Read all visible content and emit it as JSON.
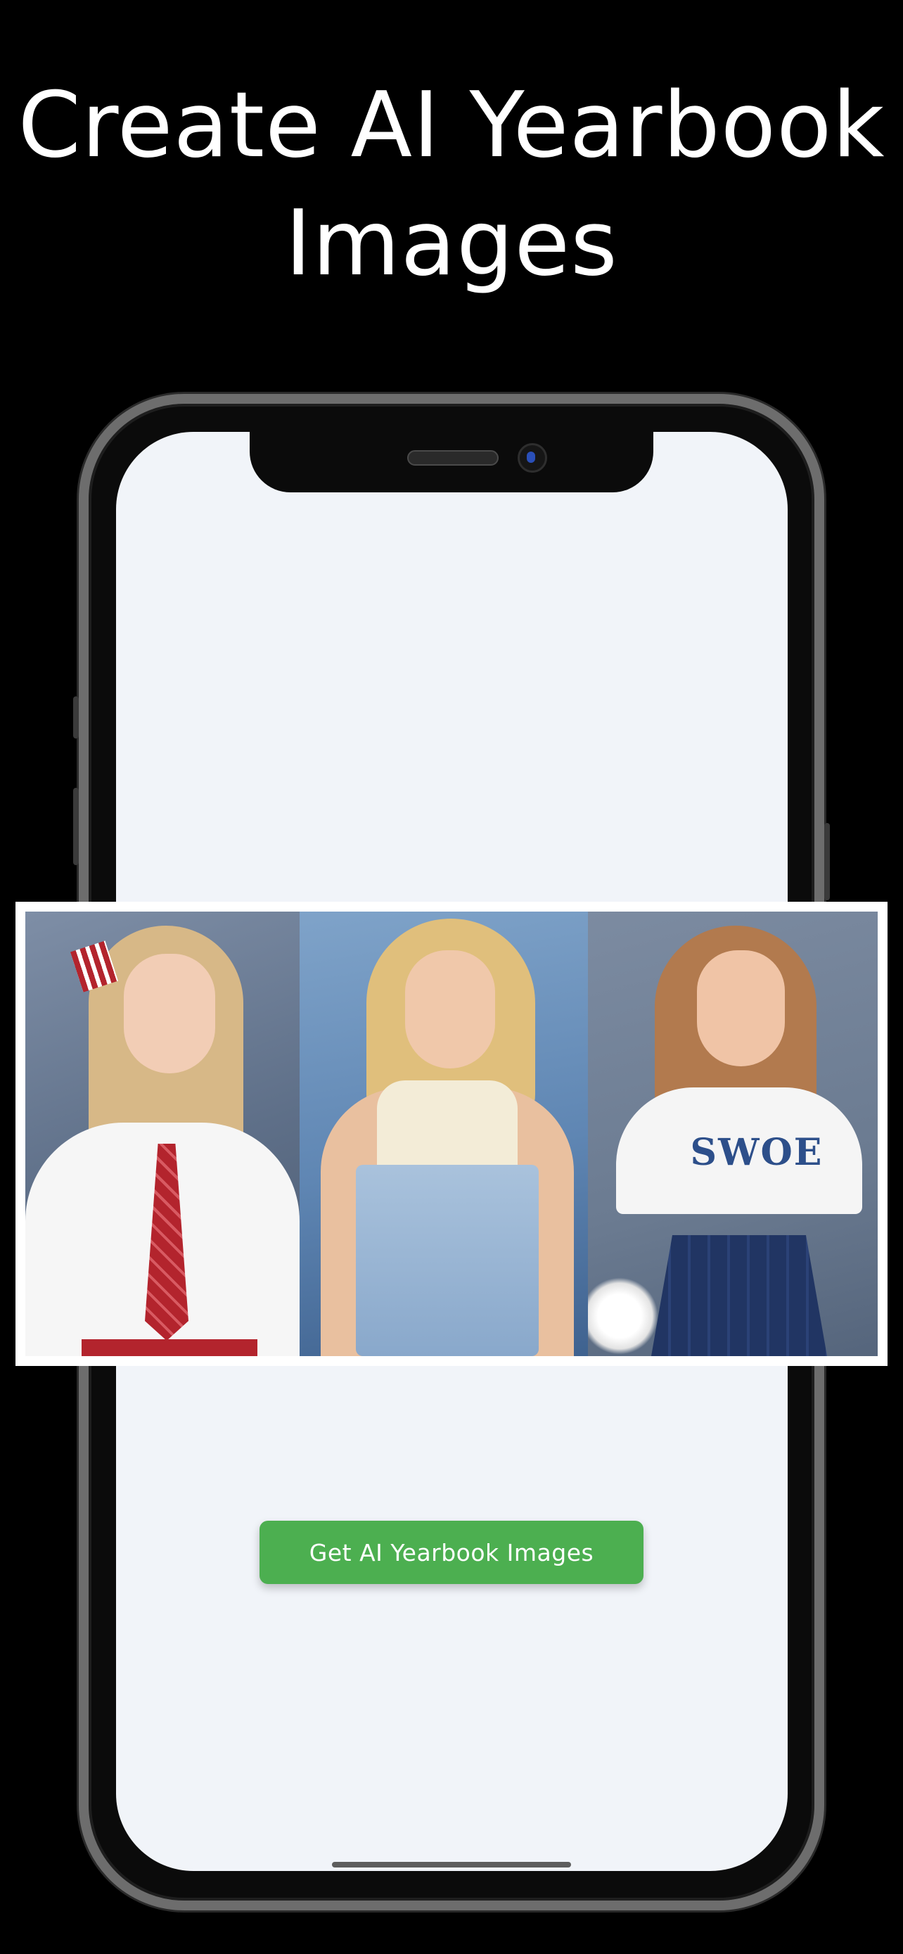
{
  "headline": {
    "line1": "Create AI Yearbook",
    "line2": "Images"
  },
  "photos": [
    {
      "subject": "girl in white blouse with red plaid tie and bow"
    },
    {
      "subject": "girl in denim overalls"
    },
    {
      "subject": "girl in white t-shirt and navy skirt",
      "shirt_text": "SWOE"
    }
  ],
  "cta": {
    "label": "Get AI Yearbook Images"
  },
  "colors": {
    "background": "#000000",
    "screen": "#f1f4f9",
    "cta": "#4caf50",
    "frame": "#6d6d6d"
  }
}
